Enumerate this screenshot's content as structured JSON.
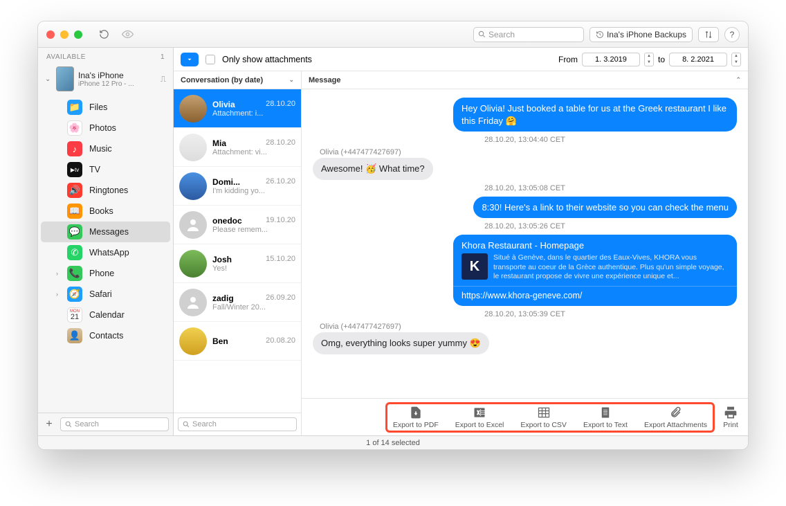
{
  "titlebar": {
    "search_placeholder": "Search",
    "backups_label": "Ina's iPhone Backups",
    "help_label": "?"
  },
  "sidebar": {
    "header": "AVAILABLE",
    "count": "1",
    "device": {
      "name": "Ina's iPhone",
      "model": "iPhone 12 Pro - ..."
    },
    "items": [
      {
        "label": "Files"
      },
      {
        "label": "Photos"
      },
      {
        "label": "Music"
      },
      {
        "label": "TV"
      },
      {
        "label": "Ringtones"
      },
      {
        "label": "Books"
      },
      {
        "label": "Messages"
      },
      {
        "label": "WhatsApp"
      },
      {
        "label": "Phone"
      },
      {
        "label": "Safari"
      },
      {
        "label": "Calendar"
      },
      {
        "label": "Contacts"
      }
    ],
    "search_placeholder": "Search"
  },
  "filter": {
    "only_attachments": "Only show attachments",
    "from": "From",
    "date_from": "1.  3.2019",
    "to": "to",
    "date_to": "8.  2.2021"
  },
  "convcol": {
    "header": "Conversation (by date)",
    "search_placeholder": "Search",
    "items": [
      {
        "name": "Olivia",
        "date": "28.10.20",
        "sub": "Attachment: i..."
      },
      {
        "name": "Mia",
        "date": "28.10.20",
        "sub": "Attachment: vi..."
      },
      {
        "name": "Domi...",
        "date": "26.10.20",
        "sub": "I'm kidding yo..."
      },
      {
        "name": "onedoc",
        "date": "19.10.20",
        "sub": "Please remem..."
      },
      {
        "name": "Josh",
        "date": "15.10.20",
        "sub": "Yes!"
      },
      {
        "name": "zadig",
        "date": "26.09.20",
        "sub": "Fall/Winter 20..."
      },
      {
        "name": "Ben",
        "date": "20.08.20",
        "sub": ""
      }
    ]
  },
  "msgcol": {
    "header": "Message"
  },
  "messages": {
    "m1": "Hey Olivia! Just booked a table for us at the Greek restaurant I like this Friday 🤗",
    "ts1": "28.10.20, 13:04:40 CET",
    "sender_olivia": "Olivia (+447477427697)",
    "m2": "Awesome! 🥳 What time?",
    "ts2": "28.10.20, 13:05:08 CET",
    "m3": "8:30! Here's a link to their website so you can check the menu",
    "ts3": "28.10.20, 13:05:26 CET",
    "link_title": "Khora Restaurant - Homepage",
    "link_desc": "Situé à Genève, dans le quartier des Eaux-Vives, KHORA vous transporte au coeur de la Grèce authentique. Plus qu'un simple voyage, le restaurant propose de vivre une expérience unique et...",
    "link_url": "https://www.khora-geneve.com/",
    "ts4": "28.10.20, 13:05:39 CET",
    "m4": "Omg, everything looks super yummy 😍"
  },
  "toolbar": {
    "pdf": "Export to PDF",
    "excel": "Export to Excel",
    "csv": "Export to CSV",
    "text": "Export to Text",
    "attach": "Export Attachments",
    "print": "Print"
  },
  "status": "1 of 14 selected"
}
